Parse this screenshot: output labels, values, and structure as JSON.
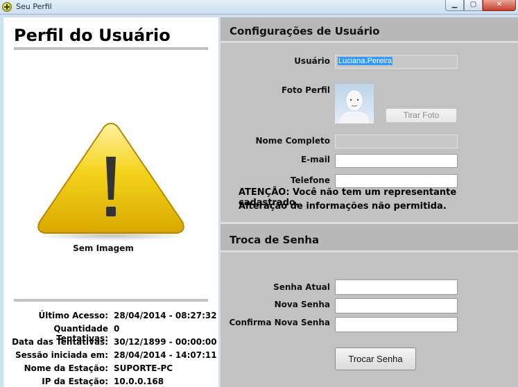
{
  "window": {
    "title": "Seu Perfil",
    "minimize_glyph": "▁",
    "maximize_glyph": "▢",
    "close_glyph": "✕"
  },
  "left": {
    "title": "Perfil do Usuário",
    "image_caption": "Sem Imagem",
    "info": [
      {
        "label": "Último Acesso:",
        "value": "28/04/2014 - 08:27:32"
      },
      {
        "label": "Quantidade Tentativas:",
        "value": "0"
      },
      {
        "label": "Data das Tentativas:",
        "value": "30/12/1899 - 00:00:00"
      },
      {
        "label": "Sessão iniciada em:",
        "value": "28/04/2014 - 14:07:11"
      },
      {
        "label": "Nome da Estação:",
        "value": "SUPORTE-PC"
      },
      {
        "label": "IP da Estação:",
        "value": "10.0.0.168"
      }
    ]
  },
  "config": {
    "title": "Configurações de Usuário",
    "usuario_label": "Usuário",
    "usuario_value": "Luciana.Pereira",
    "foto_label": "Foto Perfil",
    "tirar_foto": "Tirar Foto",
    "nome_label": "Nome Completo",
    "nome_value": "",
    "email_label": "E-mail",
    "email_value": "",
    "telefone_label": "Telefone",
    "telefone_value": "",
    "warning_line1": "ATENÇÃO: Você não tem um representante cadastrado.",
    "warning_line2": "Alteração de informações não permitida."
  },
  "password": {
    "title": "Troca de Senha",
    "atual_label": "Senha Atual",
    "nova_label": "Nova Senha",
    "confirma_label": "Confirma Nova Senha",
    "atual_value": "",
    "nova_value": "",
    "confirma_value": "",
    "button": "Trocar Senha"
  }
}
